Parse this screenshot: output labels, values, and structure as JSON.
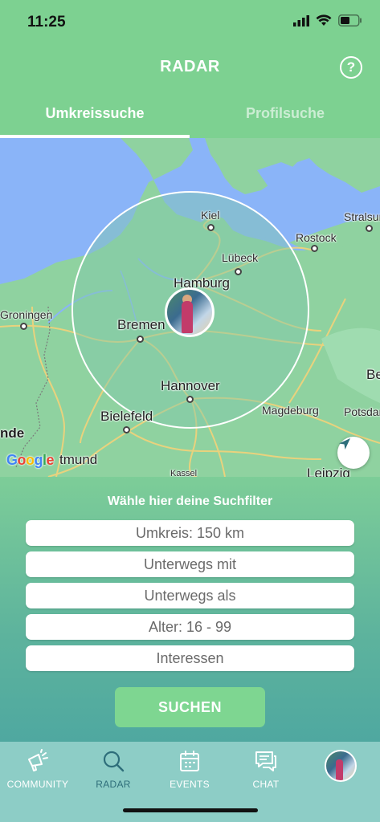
{
  "status_bar": {
    "time": "11:25"
  },
  "header": {
    "title": "RADAR",
    "help_icon": "question-circle-icon",
    "tabs": [
      {
        "label": "Umkreissuche",
        "active": true
      },
      {
        "label": "Profilsuche",
        "active": false
      }
    ]
  },
  "map": {
    "cities": {
      "kiel": "Kiel",
      "luebeck": "Lübeck",
      "hamburg": "Hamburg",
      "bremen": "Bremen",
      "hannover": "Hannover",
      "bielefeld": "Bielefeld",
      "groningen": "Groningen",
      "rostock": "Rostock",
      "stralsund": "Stralsun",
      "magdeburg": "Magdeburg",
      "potsdam": "Potsdar",
      "leipzig": "Leipzig",
      "kassel": "Kassel",
      "dortmund": "tmund",
      "nde": "nde",
      "be": "Be"
    },
    "attribution": "Google",
    "colors": {
      "water": "#8ab4f8",
      "land": "#8fd2a0",
      "radius_fill": "#80c8aa"
    }
  },
  "filters": {
    "heading": "Wähle hier deine Suchfilter",
    "fields": [
      "Umkreis: 150 km",
      "Unterwegs mit",
      "Unterwegs als",
      "Alter: 16 - 99",
      "Interessen"
    ],
    "search_button": "SUCHEN"
  },
  "bottom_nav": {
    "items": [
      {
        "label": "COMMUNITY",
        "icon": "megaphone-icon",
        "active": false
      },
      {
        "label": "RADAR",
        "icon": "search-icon",
        "active": true
      },
      {
        "label": "EVENTS",
        "icon": "calendar-icon",
        "active": false
      },
      {
        "label": "CHAT",
        "icon": "chat-icon",
        "active": false
      }
    ],
    "profile_icon": "profile-avatar"
  },
  "theme": {
    "primary": "#7dd191",
    "active_nav": "#2e6e7a",
    "nav_bg": "#8dcdc6"
  }
}
